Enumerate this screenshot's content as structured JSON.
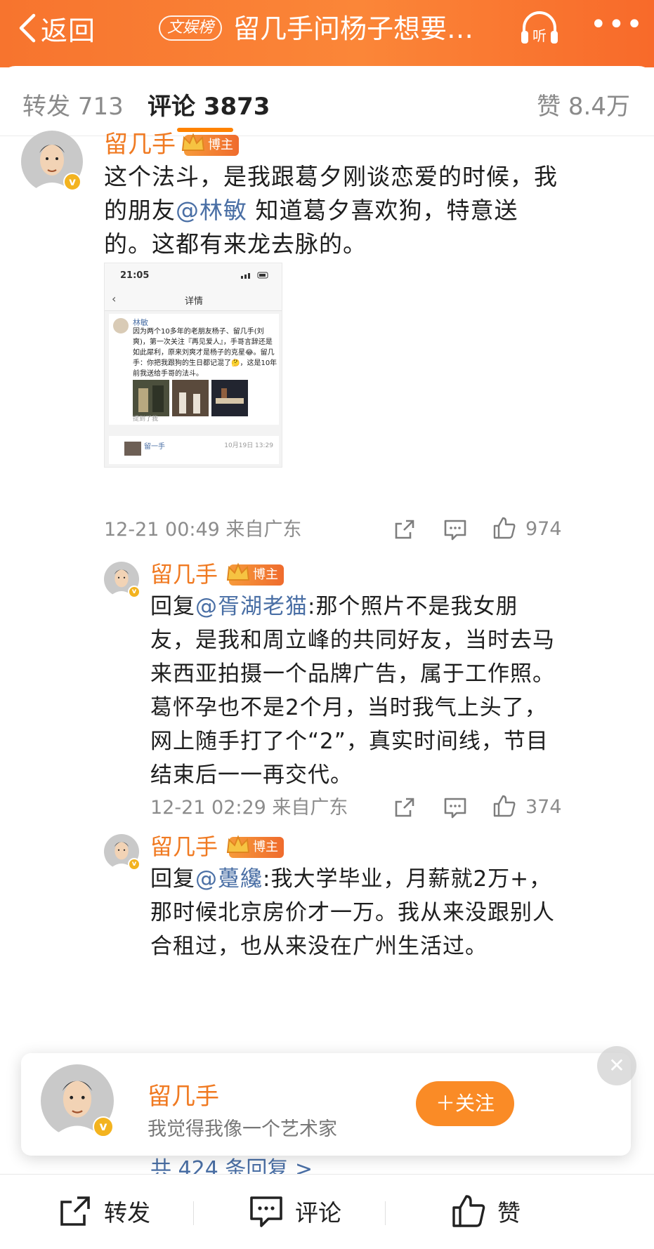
{
  "header": {
    "back_label": "返回",
    "board_badge": "文娱榜",
    "title": "留几手问杨子想要自…",
    "listen_label": "听",
    "more_label": "•••"
  },
  "tabs": {
    "repost": "转发 713",
    "comments": "评论 3873",
    "likes": "赞 8.4万"
  },
  "accent_color": "#f07a22",
  "mention_color": "#4a6fa5",
  "comments": [
    {
      "username": "留几手",
      "badge": "博主",
      "text_before": "这个法斗，是我跟葛夕刚谈恋爱的时候，我的朋友",
      "mention": "@林敏",
      "text_after": " 知道葛夕喜欢狗，特意送的。这都有来龙去脉的。",
      "meta": "12-21 00:49 来自广东",
      "likes": "974"
    },
    {
      "username": "留几手",
      "badge": "博主",
      "text_before": "回复",
      "mention": "@胥湖老猫",
      "text_after": ":那个照片不是我女朋友，是我和周立峰的共同好友，当时去马来西亚拍摄一个品牌广告，属于工作照。葛怀孕也不是2个月，当时我气上头了，网上随手打了个“2”，真实时间线，节目结束后一一再交代。",
      "meta": "12-21 02:29 来自广东",
      "likes": "374"
    },
    {
      "username": "留几手",
      "badge": "博主",
      "text_before": "回复",
      "mention": "@躉纔",
      "text_after": ":我大学毕业，月薪就2万+，那时候北京房价才一万。我从来没跟别人合租过，也从来没在广州生活过。"
    }
  ],
  "embedded_screenshot": {
    "time": "21:05",
    "nav_title": "详情",
    "author": "林敏",
    "text": "因为两个10多年的老朋友杨子、留几手(刘爽)，第一次关注『再见爱人』，手哥言辞还是如此犀利，原来刘爽才是杨子的克星😂。留几手：你把我跟狗的生日都记混了🤔，这是10年前我送给手哥的法斗。",
    "footer": "提到了我",
    "reply_author": "留一手",
    "reply_date": "10月19日 13:29"
  },
  "more_replies": "共 424 条回复 >",
  "follow_card": {
    "name": "留几手",
    "bio": "我觉得我像一个艺术家",
    "follow_label": "＋关注",
    "close_label": "✕"
  },
  "bottom_bar": {
    "repost": "转发",
    "comment": "评论",
    "like": "赞"
  }
}
